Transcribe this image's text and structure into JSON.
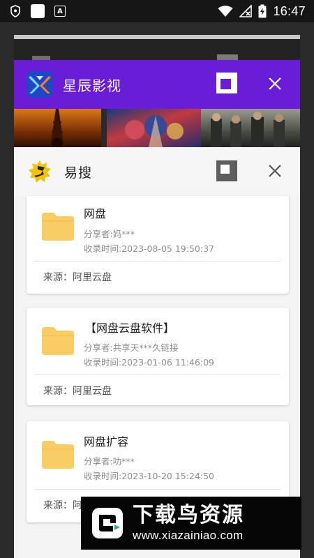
{
  "status_bar": {
    "time": "16:47",
    "icons": [
      "shield-icon",
      "square-icon",
      "a-icon",
      "wifi-icon",
      "no-signal-icon",
      "battery-charging-icon"
    ]
  },
  "recents": {
    "xingchen": {
      "title": "星辰影视",
      "header_color": "#6a1cd6"
    },
    "yisou": {
      "title": "易搜",
      "cards": [
        {
          "name": "网盘",
          "sharer": "分享者:妈***",
          "time": "收录时间:2023-08-05 19:50:37",
          "source": "来源：阿里云盘"
        },
        {
          "name": "【网盘云盘软件】",
          "sharer": "分享者:共享天***久链接",
          "time": "收录时间:2023-01-06 11:46:09",
          "source": "来源：阿里云盘"
        },
        {
          "name": "网盘扩容",
          "sharer": "分享者:叻***",
          "time": "收录时间:2023-10-20 15:24:50",
          "source": "来源：阿"
        }
      ]
    }
  },
  "watermark": {
    "title": "下载鸟资源",
    "url": "www.xiazainiao.com"
  },
  "colors": {
    "folder": "#f9cd66",
    "accent_purple": "#6a1cd6"
  }
}
